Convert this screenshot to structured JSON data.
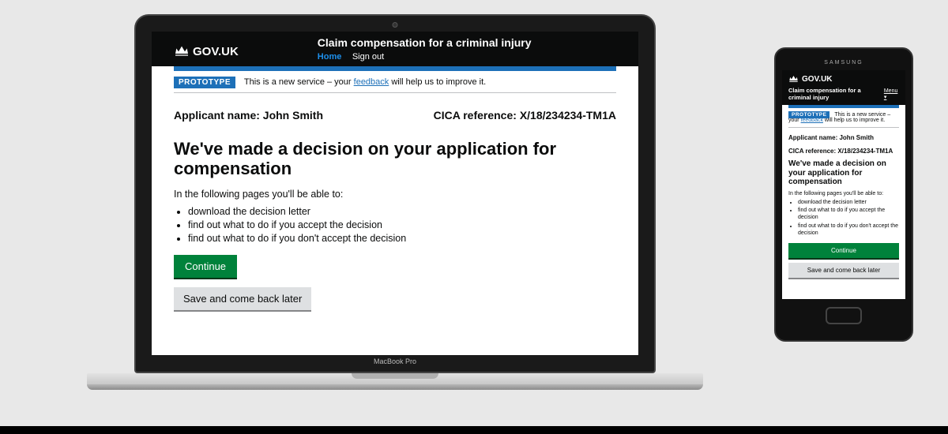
{
  "govuk_label": "GOV.UK",
  "service_name": "Claim compensation for a criminal injury",
  "nav": {
    "home": "Home",
    "sign_out": "Sign out",
    "menu": "Menu"
  },
  "phase": {
    "tag": "PROTOTYPE",
    "text_before": "This is a new service – your ",
    "link": "feedback",
    "text_after": " will help us to improve it."
  },
  "meta": {
    "applicant_label": "Applicant name:",
    "applicant_name": "John Smith",
    "ref_label": "CICA reference:",
    "ref_value": "X/18/234234-TM1A"
  },
  "heading": "We've made a decision on your application for compensation",
  "intro": "In the following pages you'll be able to:",
  "bullets": [
    "download the decision letter",
    "find out what to do if you accept the decision",
    "find out what to do if you don't accept the decision"
  ],
  "buttons": {
    "continue": "Continue",
    "save": "Save and come back later"
  },
  "devices": {
    "laptop_label": "MacBook Pro",
    "phone_brand": "SAMSUNG"
  }
}
